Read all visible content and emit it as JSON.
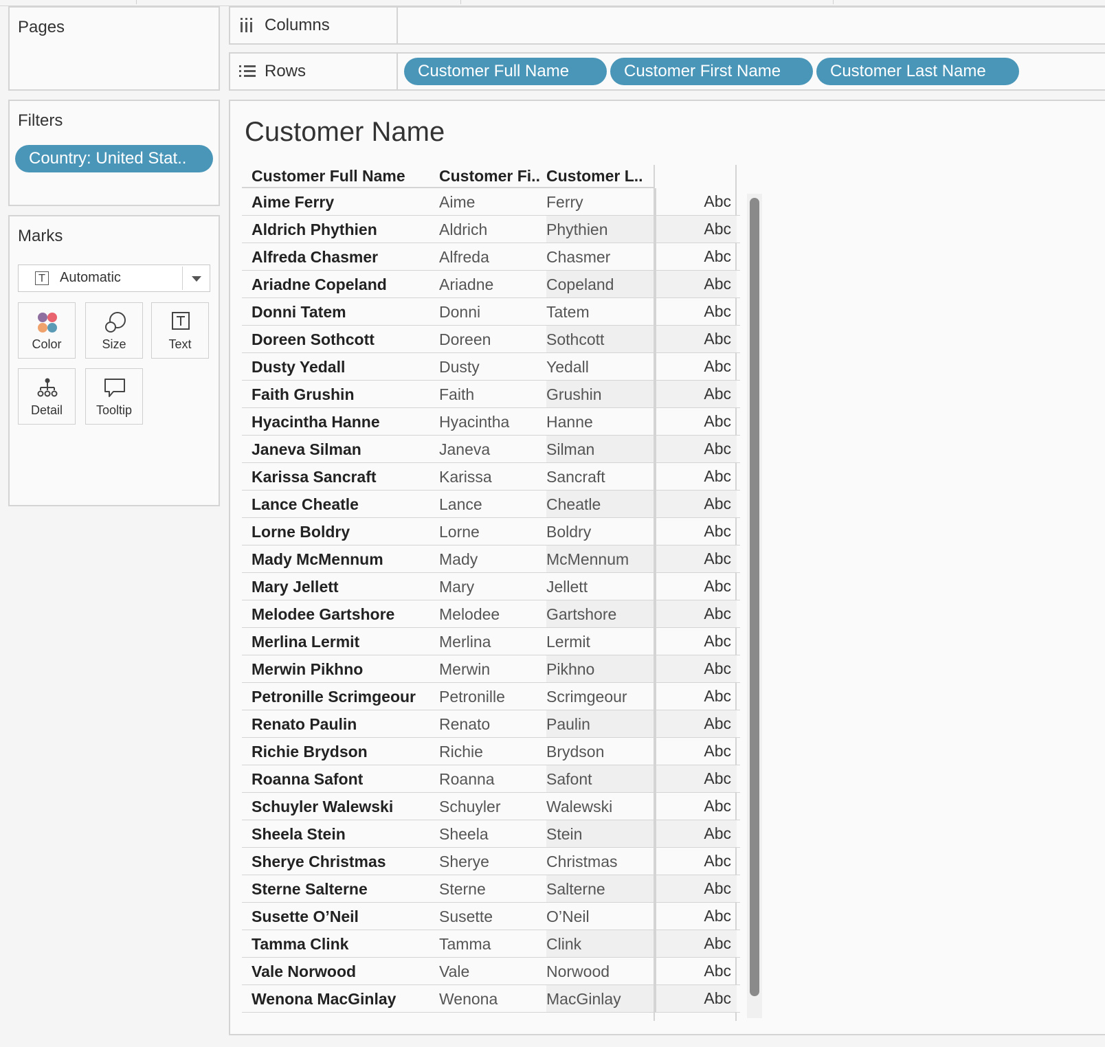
{
  "pages": {
    "title": "Pages"
  },
  "filters": {
    "title": "Filters",
    "pills": [
      "Country: United Stat.."
    ]
  },
  "marks": {
    "title": "Marks",
    "mark_type": "Automatic",
    "buttons": {
      "color": "Color",
      "size": "Size",
      "text": "Text",
      "detail": "Detail",
      "tooltip": "Tooltip"
    },
    "color_dots": [
      "#8e6fa0",
      "#e8636d",
      "#f0a26d",
      "#5b9ab5"
    ]
  },
  "columns_shelf": {
    "label": "Columns",
    "pills": []
  },
  "rows_shelf": {
    "label": "Rows",
    "pills": [
      "Customer Full Name",
      "Customer First Name",
      "Customer Last Name"
    ]
  },
  "view": {
    "title": "Customer Name",
    "headers": {
      "full": "Customer Full Name",
      "first": "Customer Fi..",
      "last": "Customer L.."
    },
    "rows": [
      {
        "full": "Aime Ferry",
        "first": "Aime",
        "last": "Ferry",
        "mark": "Abc"
      },
      {
        "full": "Aldrich Phythien",
        "first": "Aldrich",
        "last": "Phythien",
        "mark": "Abc"
      },
      {
        "full": "Alfreda Chasmer",
        "first": "Alfreda",
        "last": "Chasmer",
        "mark": "Abc"
      },
      {
        "full": "Ariadne Copeland",
        "first": "Ariadne",
        "last": "Copeland",
        "mark": "Abc"
      },
      {
        "full": "Donni Tatem",
        "first": "Donni",
        "last": "Tatem",
        "mark": "Abc"
      },
      {
        "full": "Doreen Sothcott",
        "first": "Doreen",
        "last": "Sothcott",
        "mark": "Abc"
      },
      {
        "full": "Dusty Yedall",
        "first": "Dusty",
        "last": "Yedall",
        "mark": "Abc"
      },
      {
        "full": "Faith Grushin",
        "first": "Faith",
        "last": "Grushin",
        "mark": "Abc"
      },
      {
        "full": "Hyacintha Hanne",
        "first": "Hyacintha",
        "last": "Hanne",
        "mark": "Abc"
      },
      {
        "full": "Janeva Silman",
        "first": "Janeva",
        "last": "Silman",
        "mark": "Abc"
      },
      {
        "full": "Karissa Sancraft",
        "first": "Karissa",
        "last": "Sancraft",
        "mark": "Abc"
      },
      {
        "full": "Lance Cheatle",
        "first": "Lance",
        "last": "Cheatle",
        "mark": "Abc"
      },
      {
        "full": "Lorne Boldry",
        "first": "Lorne",
        "last": "Boldry",
        "mark": "Abc"
      },
      {
        "full": "Mady McMennum",
        "first": "Mady",
        "last": "McMennum",
        "mark": "Abc"
      },
      {
        "full": "Mary Jellett",
        "first": "Mary",
        "last": "Jellett",
        "mark": "Abc"
      },
      {
        "full": "Melodee Gartshore",
        "first": "Melodee",
        "last": "Gartshore",
        "mark": "Abc"
      },
      {
        "full": "Merlina Lermit",
        "first": "Merlina",
        "last": "Lermit",
        "mark": "Abc"
      },
      {
        "full": "Merwin Pikhno",
        "first": "Merwin",
        "last": "Pikhno",
        "mark": "Abc"
      },
      {
        "full": "Petronille Scrimgeour",
        "first": "Petronille",
        "last": "Scrimgeour",
        "mark": "Abc"
      },
      {
        "full": "Renato Paulin",
        "first": "Renato",
        "last": "Paulin",
        "mark": "Abc"
      },
      {
        "full": "Richie Brydson",
        "first": "Richie",
        "last": "Brydson",
        "mark": "Abc"
      },
      {
        "full": "Roanna Safont",
        "first": "Roanna",
        "last": "Safont",
        "mark": "Abc"
      },
      {
        "full": "Schuyler Walewski",
        "first": "Schuyler",
        "last": "Walewski",
        "mark": "Abc"
      },
      {
        "full": "Sheela Stein",
        "first": "Sheela",
        "last": "Stein",
        "mark": "Abc"
      },
      {
        "full": "Sherye Christmas",
        "first": "Sherye",
        "last": "Christmas",
        "mark": "Abc"
      },
      {
        "full": "Sterne Salterne",
        "first": "Sterne",
        "last": "Salterne",
        "mark": "Abc"
      },
      {
        "full": "Susette O’Neil",
        "first": "Susette",
        "last": "O’Neil",
        "mark": "Abc"
      },
      {
        "full": "Tamma Clink",
        "first": "Tamma",
        "last": "Clink",
        "mark": "Abc"
      },
      {
        "full": "Vale Norwood",
        "first": "Vale",
        "last": "Norwood",
        "mark": "Abc"
      },
      {
        "full": "Wenona MacGinlay",
        "first": "Wenona",
        "last": "MacGinlay",
        "mark": "Abc"
      }
    ]
  },
  "colors": {
    "pill": "#4a96b8",
    "border": "#d4d4d4",
    "scroll_thumb": "#8a8a8a"
  }
}
